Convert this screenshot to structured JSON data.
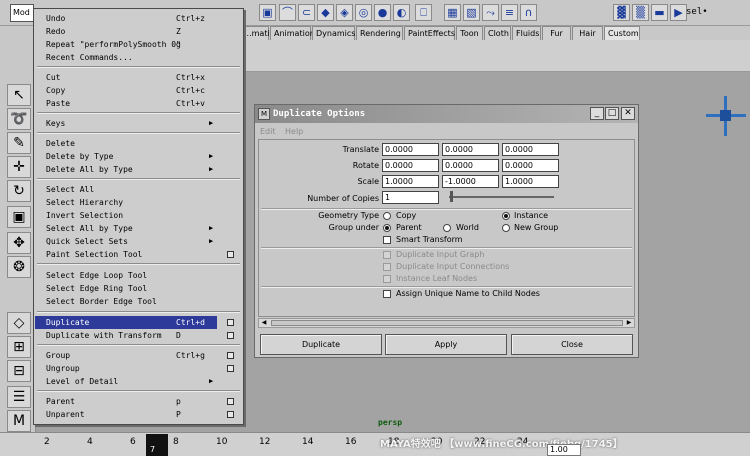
{
  "topbar": {
    "icons": [
      "select-by-component-icon",
      "magnet-curve-icon",
      "snap-curve-icon",
      "snap-point-icon",
      "snap-view-icon",
      "snap-surface-icon",
      "render-icon",
      "ipr-icon",
      "camera-icon",
      "grid-icon",
      "hypershade-icon",
      "connection-icon",
      "graph-icon",
      "magnet-icon",
      "clapper-icon",
      "clapper-alt-icon",
      "film-icon",
      "playback-icon"
    ],
    "sel_readout": "sel•"
  },
  "shelf_tabs": [
    "...mation",
    "Animation",
    "Dynamics",
    "Rendering",
    "PaintEffects",
    "Toon",
    "Cloth",
    "Fluids",
    "Fur",
    "Hair",
    "Custom"
  ],
  "edit_menu": {
    "title": "Mod",
    "items": [
      {
        "label": "Undo",
        "shortcut": "Ctrl+z"
      },
      {
        "label": "Redo",
        "shortcut": "Z"
      },
      {
        "label": "Repeat \"performPolySmooth 0\"",
        "shortcut": "g"
      },
      {
        "label": "Recent Commands..."
      },
      {
        "label": "Cut",
        "shortcut": "Ctrl+x"
      },
      {
        "label": "Copy",
        "shortcut": "Ctrl+c"
      },
      {
        "label": "Paste",
        "shortcut": "Ctrl+v"
      },
      {
        "label": "Keys",
        "arrow": "▶"
      },
      {
        "label": "Delete"
      },
      {
        "label": "Delete by Type",
        "arrow": "▶"
      },
      {
        "label": "Delete All by Type",
        "arrow": "▶"
      },
      {
        "label": "Select All"
      },
      {
        "label": "Select Hierarchy"
      },
      {
        "label": "Invert Selection"
      },
      {
        "label": "Select All by Type",
        "arrow": "▶"
      },
      {
        "label": "Quick Select Sets",
        "arrow": "▶"
      },
      {
        "label": "Paint Selection Tool"
      },
      {
        "label": "Select Edge Loop Tool"
      },
      {
        "label": "Select Edge Ring Tool"
      },
      {
        "label": "Select Border Edge Tool"
      },
      {
        "label": "Duplicate",
        "shortcut": "Ctrl+d"
      },
      {
        "label": "Duplicate with Transform",
        "shortcut": "D"
      },
      {
        "label": "Group",
        "shortcut": "Ctrl+g"
      },
      {
        "label": "Ungroup"
      },
      {
        "label": "Level of Detail",
        "arrow": "▶"
      },
      {
        "label": "Parent",
        "shortcut": "p"
      },
      {
        "label": "Unparent",
        "shortcut": "P"
      }
    ]
  },
  "dialog": {
    "title": "Duplicate Options",
    "app_icon": "M",
    "minimize": "_",
    "maximize": "□",
    "close": "✕",
    "menu_edit": "Edit",
    "menu_help": "Help",
    "translate_label": "Translate",
    "translate": [
      "0.0000",
      "0.0000",
      "0.0000"
    ],
    "rotate_label": "Rotate",
    "rotate": [
      "0.0000",
      "0.0000",
      "0.0000"
    ],
    "scale_label": "Scale",
    "scale": [
      "1.0000",
      "-1.0000",
      "1.0000"
    ],
    "copies_label": "Number of Copies",
    "copies": "1",
    "geometry_type_label": "Geometry Type",
    "geometry_copy": "Copy",
    "geometry_instance": "Instance",
    "group_under_label": "Group under",
    "group_parent": "Parent",
    "group_world": "World",
    "group_new": "New Group",
    "smart_transform": "Smart Transform",
    "dup_input_graph": "Duplicate Input Graph",
    "dup_input_connections": "Duplicate Input Connections",
    "instance_leaf_nodes": "Instance Leaf Nodes",
    "assign_unique_name": "Assign Unique Name to Child Nodes",
    "btn_duplicate": "Duplicate",
    "btn_apply": "Apply",
    "btn_close": "Close",
    "scroll_left": "◀",
    "scroll_right": "▶"
  },
  "viewport": {
    "camera": "persp"
  },
  "timeline": {
    "ticks": [
      "2",
      "4",
      "6",
      "8",
      "10",
      "12",
      "14",
      "16",
      "18",
      "20",
      "22",
      "24"
    ],
    "current_frame": "7",
    "range_end": "1.00",
    "watermark": "MAYA特效吧 【www.fineCG.com/fiebq/1745】"
  },
  "toolbox_icons": [
    "select-arrow-icon",
    "lasso-icon",
    "paint-select-icon",
    "move-icon",
    "rotate-icon",
    "scale-icon",
    "manipulator-icon",
    "soft-mod-icon",
    "layout-single-icon",
    "layout-four-icon",
    "layout-two-icon",
    "outliner-icon",
    "maya-logo-icon"
  ]
}
